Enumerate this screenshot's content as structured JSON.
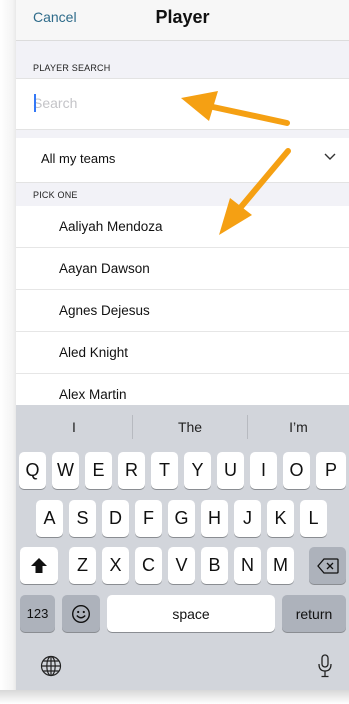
{
  "navbar": {
    "cancel_label": "Cancel",
    "title": "Player"
  },
  "search": {
    "header": "PLAYER SEARCH",
    "placeholder": "Search",
    "value": ""
  },
  "filter": {
    "selected": "All my teams"
  },
  "list": {
    "header": "PICK ONE",
    "items": [
      {
        "label": "Aaliyah Mendoza"
      },
      {
        "label": "Aayan Dawson"
      },
      {
        "label": "Agnes Dejesus"
      },
      {
        "label": "Aled Knight"
      },
      {
        "label": "Alex Martin"
      }
    ]
  },
  "keyboard": {
    "predictions": [
      "I",
      "The",
      "I’m"
    ],
    "row1": [
      "Q",
      "W",
      "E",
      "R",
      "T",
      "Y",
      "U",
      "I",
      "O",
      "P"
    ],
    "row2": [
      "A",
      "S",
      "D",
      "F",
      "G",
      "H",
      "J",
      "K",
      "L"
    ],
    "row3": [
      "Z",
      "X",
      "C",
      "V",
      "B",
      "N",
      "M"
    ],
    "numbers_label": "123",
    "space_label": "space",
    "return_label": "return"
  },
  "icons": {
    "chevron": "chevron-down-icon",
    "shift": "shift-icon",
    "delete": "delete-icon",
    "emoji": "emoji-icon",
    "globe": "globe-icon",
    "mic": "microphone-icon"
  },
  "colors": {
    "accent": "#2e6b8a",
    "annotation_arrow": "#f5a013",
    "caret": "#3478f6"
  }
}
